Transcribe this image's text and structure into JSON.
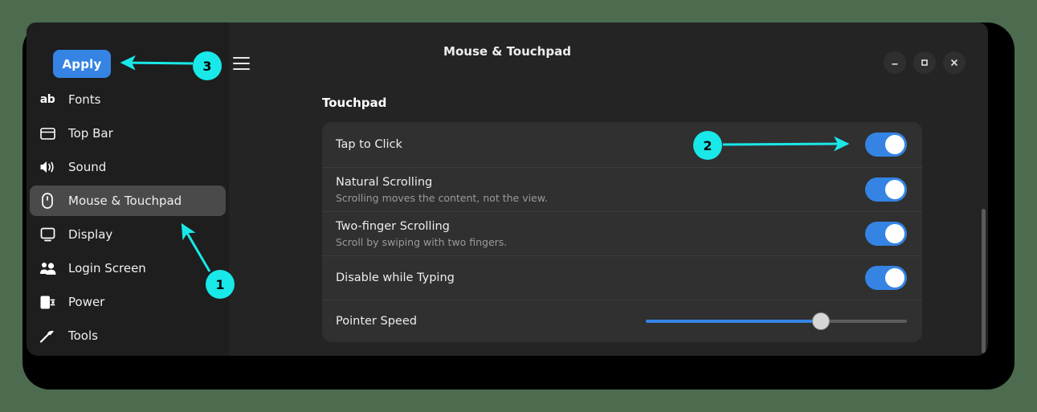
{
  "desktop": {
    "background_color": "#4c6b4f"
  },
  "window": {
    "title": "Mouse & Touchpad",
    "apply_label": "Apply",
    "menu_icon": "hamburger-menu-icon",
    "controls": {
      "minimize": "minimize-icon",
      "maximize": "maximize-icon",
      "close": "close-icon"
    }
  },
  "sidebar": {
    "items": [
      {
        "label": "Fonts",
        "icon": "fonts-icon",
        "selected": false
      },
      {
        "label": "Top Bar",
        "icon": "top-bar-icon",
        "selected": false
      },
      {
        "label": "Sound",
        "icon": "sound-icon",
        "selected": false
      },
      {
        "label": "Mouse & Touchpad",
        "icon": "mouse-icon",
        "selected": true
      },
      {
        "label": "Display",
        "icon": "display-icon",
        "selected": false
      },
      {
        "label": "Login Screen",
        "icon": "login-screen-icon",
        "selected": false
      },
      {
        "label": "Power",
        "icon": "power-icon",
        "selected": false
      },
      {
        "label": "Tools",
        "icon": "tools-icon",
        "selected": false
      }
    ]
  },
  "main": {
    "section_title": "Touchpad",
    "rows": [
      {
        "title": "Tap to Click",
        "subtitle": "",
        "control": "toggle",
        "value": "on"
      },
      {
        "title": "Natural Scrolling",
        "subtitle": "Scrolling moves the content, not the view.",
        "control": "toggle",
        "value": "on"
      },
      {
        "title": "Two-finger Scrolling",
        "subtitle": "Scroll by swiping with two fingers.",
        "control": "toggle",
        "value": "on"
      },
      {
        "title": "Disable while Typing",
        "subtitle": "",
        "control": "toggle",
        "value": "on"
      },
      {
        "title": "Pointer Speed",
        "subtitle": "",
        "control": "slider",
        "value": 67
      }
    ]
  },
  "annotations": {
    "accent_color": "#19e8e8",
    "markers": [
      {
        "label": "1",
        "target": "sidebar-item-mouse-touchpad"
      },
      {
        "label": "2",
        "target": "tap-to-click-toggle"
      },
      {
        "label": "3",
        "target": "apply-button"
      }
    ]
  },
  "colors": {
    "accent_blue": "#3584e4",
    "window_bg": "#242424",
    "sidebar_bg": "#1e1e1e",
    "card_bg": "#303030",
    "annotation_cyan": "#19e8e8"
  }
}
